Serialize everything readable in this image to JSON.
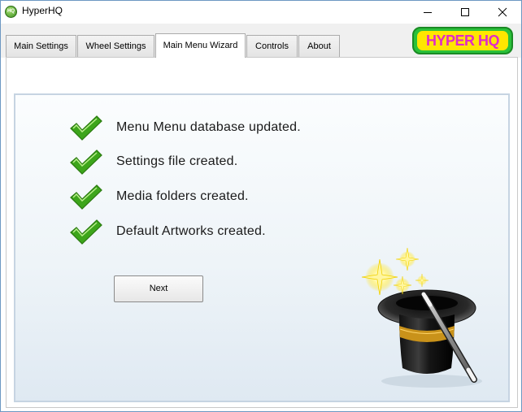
{
  "window": {
    "title": "HyperHQ",
    "icon": "hyperhq-app-icon",
    "icon_text": "HQ",
    "controls": {
      "minimize": "minimize-icon",
      "maximize": "maximize-icon",
      "close": "close-icon"
    }
  },
  "tabs": [
    {
      "label": "Main Settings",
      "active": false
    },
    {
      "label": "Wheel Settings",
      "active": false
    },
    {
      "label": "Main Menu Wizard",
      "active": true
    },
    {
      "label": "Controls",
      "active": false
    },
    {
      "label": "About",
      "active": false
    }
  ],
  "logo": {
    "text": "HYPER HQ",
    "colors": {
      "outer": "#2ac13a",
      "inner": "#ffe600",
      "text": "#e02ac8"
    }
  },
  "wizard": {
    "status_items": [
      {
        "icon": "checkmark-icon",
        "text": "Menu Menu database updated."
      },
      {
        "icon": "checkmark-icon",
        "text": "Settings file created."
      },
      {
        "icon": "checkmark-icon",
        "text": "Media folders created."
      },
      {
        "icon": "checkmark-icon",
        "text": "Default Artworks created."
      }
    ],
    "next_label": "Next",
    "illustration": "magic-hat-wand-icon"
  },
  "colors": {
    "check_green": "#3da51b",
    "panel_border": "#c6d4e2",
    "window_border": "#6d98c2"
  }
}
